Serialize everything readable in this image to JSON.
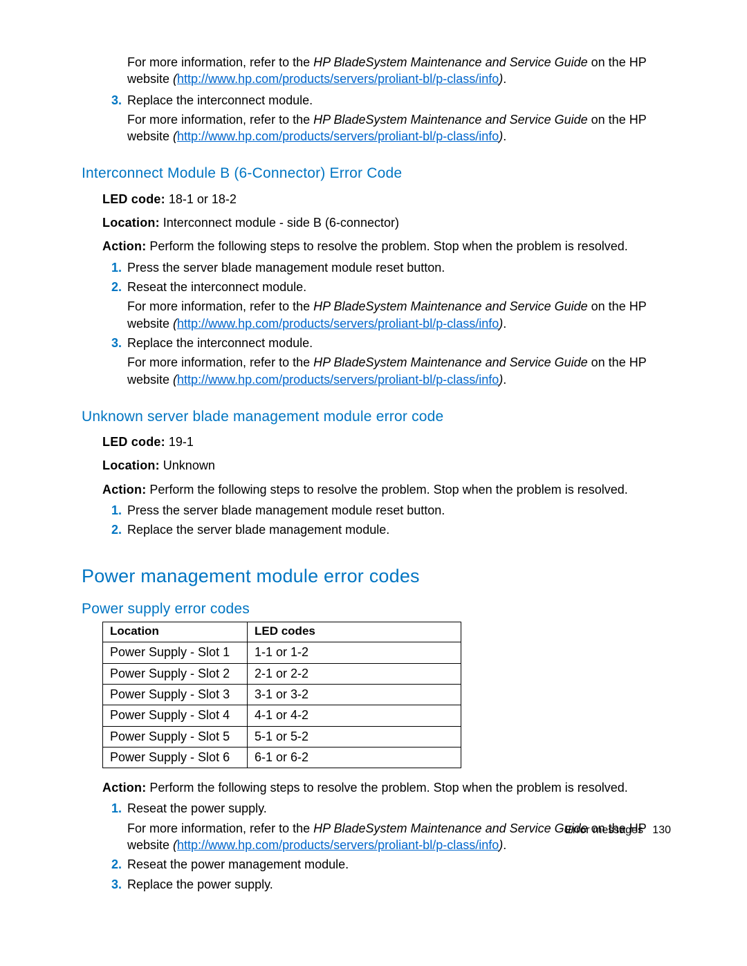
{
  "ref": {
    "prefix": "For more information, refer to the ",
    "guide_title": "HP BladeSystem Maintenance and Service Guide",
    "mid": " on the HP website ",
    "paren_open": "(",
    "url": "http://www.hp.com/products/servers/proliant-bl/p-class/info",
    "paren_close": ")",
    "period": "."
  },
  "secA": {
    "step3_a": "Replace the interconnect module."
  },
  "secB": {
    "heading": "Interconnect Module B (6-Connector) Error Code",
    "led_label": "LED code:",
    "led_value": " 18-1 or 18-2",
    "loc_label": "Location:",
    "loc_value": " Interconnect module - side B (6-connector)",
    "act_label": "Action:",
    "act_value": " Perform the following steps to resolve the problem. Stop when the problem is resolved.",
    "step1": "Press the server blade management module reset button.",
    "step2": "Reseat the interconnect module.",
    "step3": "Replace the interconnect module."
  },
  "secC": {
    "heading": "Unknown server blade management module error code",
    "led_label": "LED code:",
    "led_value": " 19-1",
    "loc_label": "Location:",
    "loc_value": " Unknown",
    "act_label": "Action:",
    "act_value": " Perform the following steps to resolve the problem. Stop when the problem is resolved.",
    "step1": "Press the server blade management module reset button.",
    "step2": "Replace the server blade management module."
  },
  "secD": {
    "heading": "Power management module error codes",
    "sub": "Power supply error codes",
    "table": {
      "h1": "Location",
      "h2": "LED codes",
      "rows": [
        {
          "c1": "Power Supply - Slot 1",
          "c2": "1-1 or 1-2"
        },
        {
          "c1": "Power Supply - Slot 2",
          "c2": "2-1 or 2-2"
        },
        {
          "c1": "Power Supply - Slot 3",
          "c2": "3-1 or 3-2"
        },
        {
          "c1": "Power Supply - Slot 4",
          "c2": "4-1 or 4-2"
        },
        {
          "c1": "Power Supply - Slot 5",
          "c2": "5-1 or 5-2"
        },
        {
          "c1": "Power Supply - Slot 6",
          "c2": "6-1 or 6-2"
        }
      ]
    },
    "act_label": "Action:",
    "act_value": " Perform the following steps to resolve the problem. Stop when the problem is resolved.",
    "step1": "Reseat the power supply.",
    "step2": "Reseat the power management module.",
    "step3": "Replace the power supply."
  },
  "footer": {
    "section": "Error messages",
    "page": "130"
  }
}
